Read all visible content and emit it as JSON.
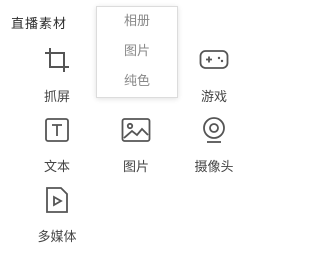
{
  "section": {
    "title": "直播素材"
  },
  "tiles": [
    {
      "label": "抓屏",
      "icon": "crop-icon"
    },
    {
      "label": "游戏",
      "icon": "gamepad-icon"
    },
    {
      "label": "文本",
      "icon": "text-icon"
    },
    {
      "label": "图片",
      "icon": "image-icon"
    },
    {
      "label": "摄像头",
      "icon": "webcam-icon"
    },
    {
      "label": "多媒体",
      "icon": "media-file-icon"
    }
  ],
  "dropdown": {
    "items": [
      "相册",
      "图片",
      "纯色"
    ]
  },
  "colors": {
    "icon_stroke": "#555555",
    "text": "#444444",
    "menu_text": "#888888"
  }
}
